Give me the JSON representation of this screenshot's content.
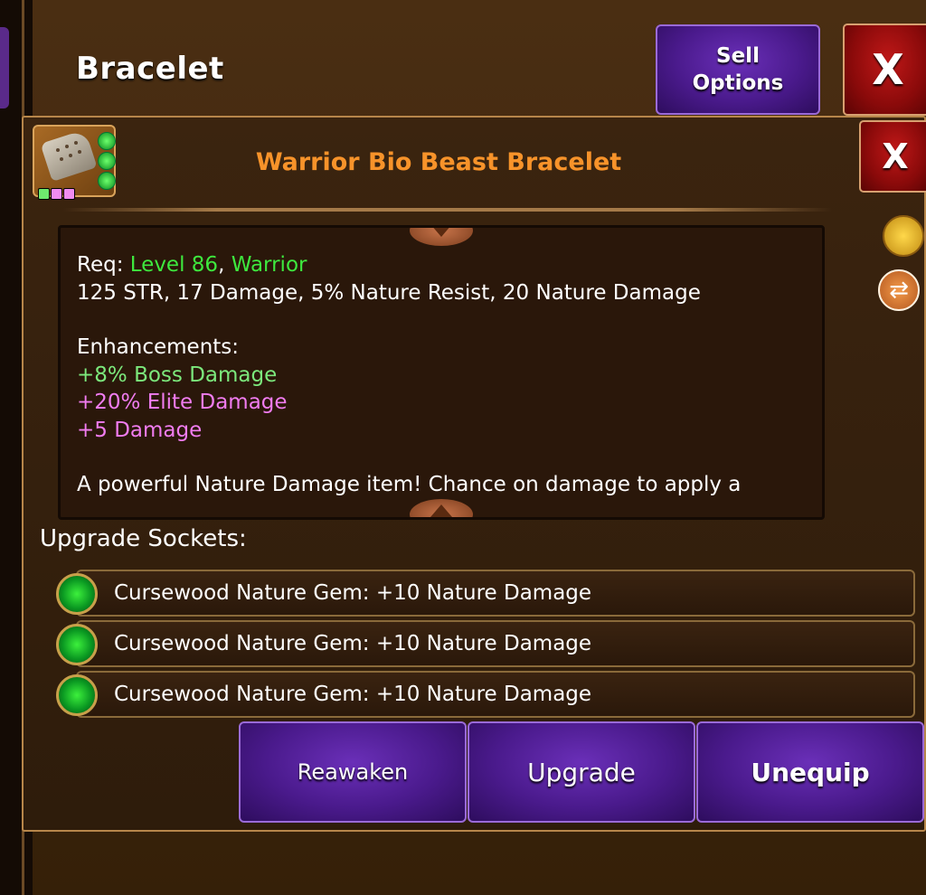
{
  "header": {
    "title": "Bracelet",
    "sell_options_label": "Sell\nOptions",
    "close_label": "X"
  },
  "panel": {
    "close_label": "X",
    "item_name": "Warrior Bio Beast Bracelet",
    "requirements": {
      "prefix": "Req: ",
      "level": "Level 86",
      "separator": ", ",
      "class": "Warrior"
    },
    "stats": "125 STR, 17 Damage, 5% Nature Resist, 20 Nature Damage",
    "enhancements_label": "Enhancements:",
    "enhancements": [
      "+8% Boss Damage",
      "+20% Elite Damage",
      "+5 Damage"
    ],
    "description": "A powerful Nature Damage item! Chance on damage to apply a",
    "sockets_label": "Upgrade Sockets:",
    "sockets": [
      "Cursewood Nature Gem: +10 Nature Damage",
      "Cursewood Nature Gem: +10 Nature Damage",
      "Cursewood Nature Gem: +10 Nature Damage"
    ]
  },
  "actions": {
    "reawaken": "Reawaken",
    "upgrade": "Upgrade",
    "unequip": "Unequip"
  },
  "icons": {
    "item": "bracelet-icon",
    "coin": "coin-bag-icon",
    "swap": "swap-icon",
    "gem": "nature-gem-icon"
  },
  "colors": {
    "item_name": "#f7932a",
    "requirement": "#3ee83e",
    "enh_green": "#7ce87c",
    "enh_pink": "#f07cf0",
    "button_purple": "#4a1a8c",
    "close_red": "#a00e0e"
  }
}
